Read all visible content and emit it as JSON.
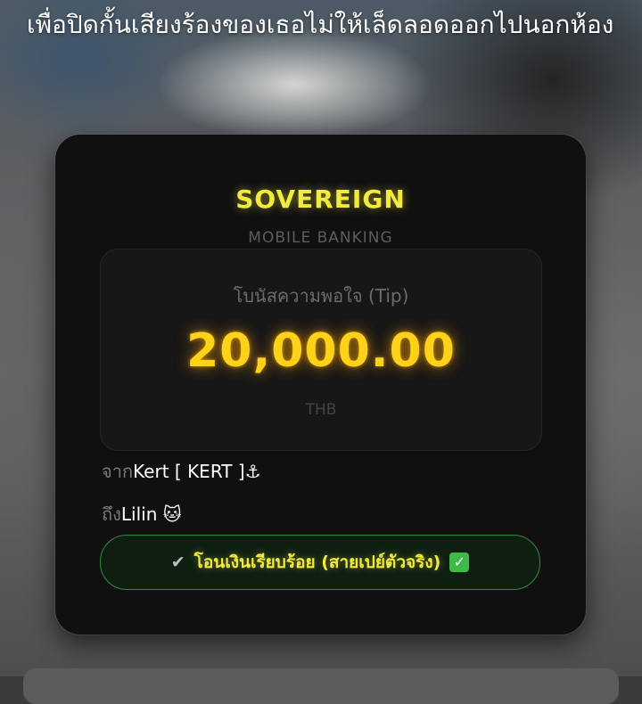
{
  "caption": {
    "text": "เพื่อปิดกั้นเสียงร้องของเธอไม่ให้เล็ดลอดออกไปนอกห้อง"
  },
  "card": {
    "brand": "SOVEREIGN",
    "brand_sub": "MOBILE BANKING",
    "tip_label": "โบนัสความพอใจ (Tip)",
    "amount": "20,000.00",
    "currency": "THB",
    "from_prefix": "จาก",
    "from_value": "Kert [ KERT ]⚓",
    "to_prefix": "ถึง",
    "to_value": "Lilin 🐱",
    "status_text": "โอนเงินเรียบร้อย (สายเปย์ตัวจริง)",
    "status_check_left": "✔",
    "status_check_right": "✓"
  },
  "colors": {
    "brand": "#f2ea3c",
    "amount": "#ffd21a",
    "status_border": "#2f8a3e",
    "card_bg": "#101010"
  }
}
